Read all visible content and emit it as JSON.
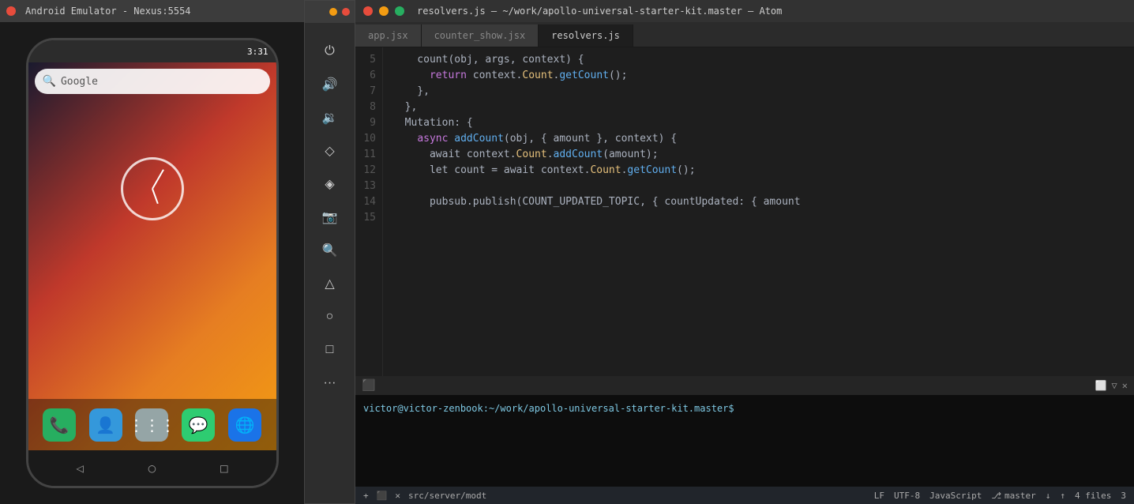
{
  "android": {
    "title": "Android Emulator - Nexus:5554",
    "status_time": "3:31",
    "search_placeholder": "Google",
    "nav_back": "◁",
    "nav_home": "○",
    "nav_recent": "□"
  },
  "controls": {
    "buttons": [
      {
        "icon": "⏻",
        "name": "power"
      },
      {
        "icon": "🔊",
        "name": "volume-up"
      },
      {
        "icon": "🔉",
        "name": "volume-down"
      },
      {
        "icon": "◇",
        "name": "rotate-left"
      },
      {
        "icon": "◈",
        "name": "rotate-right"
      },
      {
        "icon": "📷",
        "name": "screenshot"
      },
      {
        "icon": "🔍",
        "name": "zoom"
      },
      {
        "icon": "△",
        "name": "back"
      },
      {
        "icon": "○",
        "name": "home"
      },
      {
        "icon": "□",
        "name": "overview"
      },
      {
        "icon": "···",
        "name": "more"
      }
    ]
  },
  "atom": {
    "title": "resolvers.js — ~/work/apollo-universal-starter-kit.master — Atom",
    "tabs": [
      {
        "label": "app.jsx",
        "active": false
      },
      {
        "label": "counter_show.jsx",
        "active": false
      },
      {
        "label": "resolvers.js",
        "active": true
      }
    ],
    "code": {
      "lines": [
        {
          "num": 5,
          "tokens": [
            {
              "t": "    count(obj, args, context) {",
              "c": "default"
            }
          ]
        },
        {
          "num": 6,
          "tokens": [
            {
              "t": "      return context.",
              "c": "default"
            },
            {
              "t": "Count",
              "c": "obj"
            },
            {
              "t": ".",
              "c": "default"
            },
            {
              "t": "getCount",
              "c": "fn"
            },
            {
              "t": "();",
              "c": "default"
            }
          ]
        },
        {
          "num": 7,
          "tokens": [
            {
              "t": "    },",
              "c": "default"
            }
          ]
        },
        {
          "num": 8,
          "tokens": [
            {
              "t": "  },",
              "c": "default"
            }
          ]
        },
        {
          "num": 9,
          "tokens": [
            {
              "t": "  Mutation: {",
              "c": "default"
            }
          ]
        },
        {
          "num": 10,
          "tokens": [
            {
              "t": "    ",
              "c": "default"
            },
            {
              "t": "async",
              "c": "kw"
            },
            {
              "t": " ",
              "c": "default"
            },
            {
              "t": "addCount",
              "c": "fn"
            },
            {
              "t": "(obj, { amount }, context) {",
              "c": "default"
            }
          ]
        },
        {
          "num": 11,
          "tokens": [
            {
              "t": "      await context.",
              "c": "default"
            },
            {
              "t": "Count",
              "c": "obj"
            },
            {
              "t": ".",
              "c": "default"
            },
            {
              "t": "addCount",
              "c": "fn"
            },
            {
              "t": "(amount);",
              "c": "default"
            }
          ]
        },
        {
          "num": 12,
          "tokens": [
            {
              "t": "      let count = await context.",
              "c": "default"
            },
            {
              "t": "Count",
              "c": "obj"
            },
            {
              "t": ".",
              "c": "default"
            },
            {
              "t": "getCount",
              "c": "fn"
            },
            {
              "t": "();",
              "c": "default"
            }
          ]
        },
        {
          "num": 13,
          "tokens": [
            {
              "t": "",
              "c": "default"
            }
          ]
        },
        {
          "num": 14,
          "tokens": [
            {
              "t": "      pubsub.publish(COUNT_UPDATED_TOPIC, { countUpdated: { amount",
              "c": "default"
            }
          ]
        }
      ]
    },
    "terminal": {
      "prompt": "victor@victor-zenbook:~/work/apollo-universal-starter-kit.master$"
    },
    "statusbar": {
      "add_icon": "+",
      "terminal_icon": "⬛",
      "close_icon": "✕",
      "path": "src/server/modt",
      "line_ending": "LF",
      "encoding": "UTF-8",
      "language": "JavaScript",
      "branch_icon": "⎇",
      "branch": "master",
      "arrow_down": "↓",
      "arrow_up": "↑",
      "files": "4 files",
      "count": "3"
    }
  }
}
